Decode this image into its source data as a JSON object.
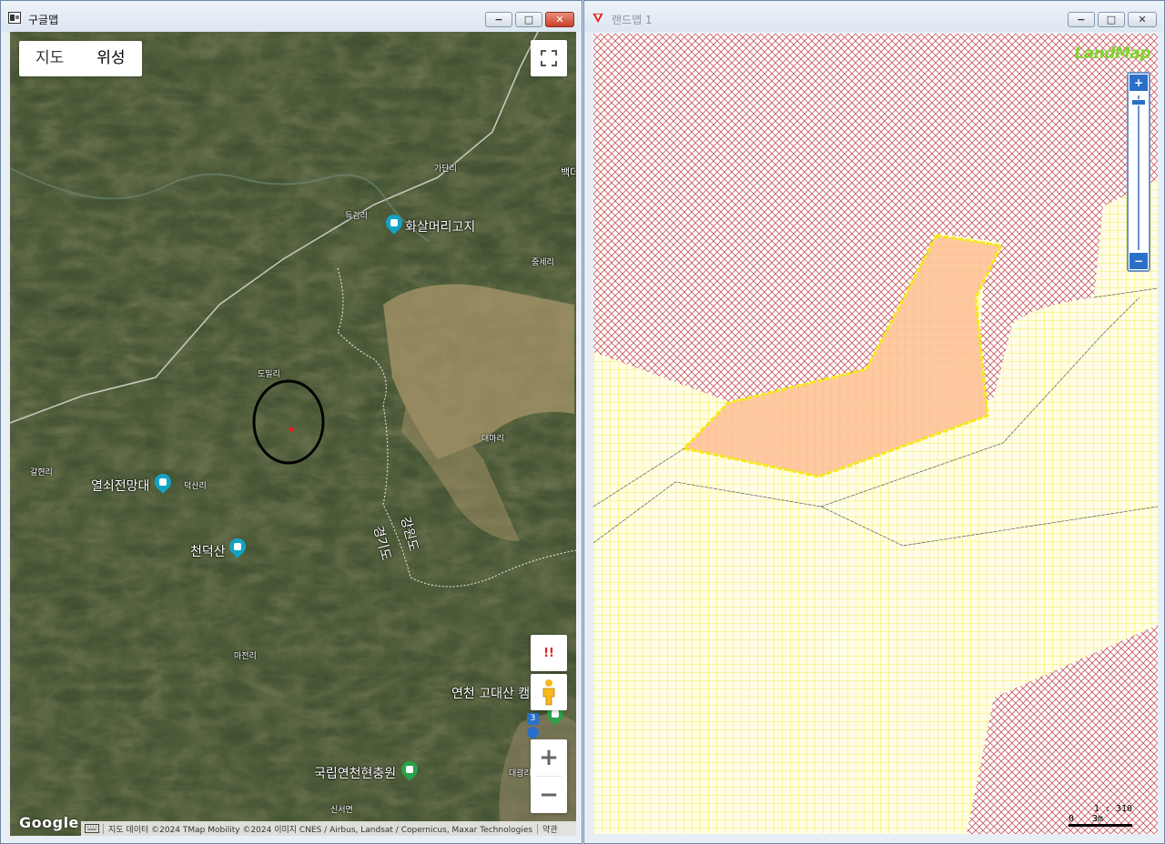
{
  "left_window": {
    "title": "구글맵",
    "min_icon": "−",
    "max_icon": "□",
    "close_icon": "✕"
  },
  "google_map": {
    "map_type": {
      "map_label": "지도",
      "satellite_label": "위성",
      "selected": "위성"
    },
    "labels": {
      "gadan": "가단리",
      "baek": "백더",
      "deuk": "득검리",
      "hwasal": "화살머리고지",
      "jung": "중세리",
      "domil": "도밀리",
      "daema": "대마리",
      "galhyeon": "갈현리",
      "yeolsoe": "열쇠전망대",
      "deoksan": "덕산리",
      "cheondeok": "천덕산",
      "gyeonggi": "경기도",
      "gangwon": "강원도",
      "majeon": "마전리",
      "yeoncheon": "연천 고대산 캠",
      "gungrip": "국립연천현충원",
      "daegwang": "대광리",
      "sinseo": "신서면"
    },
    "controls": {
      "warn_label": "!!",
      "zoom_in": "+",
      "zoom_out": "−",
      "route_badge": "3"
    },
    "logo": "Google",
    "attribution": {
      "data": "지도 데이터 ©2024 TMap Mobility ©2024 이미지 CNES / Airbus, Landsat / Copernicus, Maxar Technologies",
      "terms": "약관"
    }
  },
  "right_window": {
    "title": "랜드맵 1",
    "min_icon": "−",
    "max_icon": "□",
    "close_icon": "✕"
  },
  "land_map": {
    "logo": "LandMap",
    "zoom_plus": "+",
    "zoom_minus": "−",
    "scale_ratio": "1 : 310",
    "scale_zero": "0",
    "scale_len": "3m",
    "colors": {
      "forest_hatch": "#c9545a",
      "farmland_grid": "#f2ee55",
      "parcel_fill": "#ffc9a0",
      "parcel_outline": "#f5e91a"
    }
  }
}
